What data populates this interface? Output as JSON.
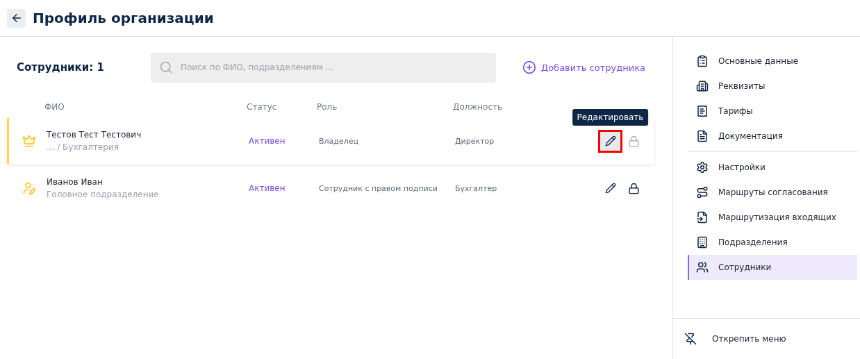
{
  "header": {
    "title": "Профиль организации"
  },
  "toolbar": {
    "count_label": "Сотрудники: 1",
    "search": {
      "placeholder": "Поиск по ФИО, подразделениям ..."
    },
    "add_button": "Добавить сотрудника"
  },
  "table": {
    "columns": [
      "ФИО",
      "Статус",
      "Роль",
      "Должность"
    ],
    "rows": [
      {
        "kind": "owner",
        "highlighted": true,
        "name": "Тестов Тест Тестович",
        "department": "... / Бухгалтерия",
        "status": "Активен",
        "role": "Владелец",
        "position": "Директор",
        "edit_focused": true,
        "edit_tooltip": "Редактировать",
        "lock_disabled": true
      },
      {
        "kind": "signer",
        "highlighted": false,
        "name": "Иванов Иван",
        "department": "Головное подразделение",
        "status": "Активен",
        "role": "Сотрудник с правом подписи",
        "position": "Бухгалтер",
        "edit_focused": false,
        "lock_disabled": false
      }
    ]
  },
  "sidebar": {
    "groups": [
      [
        {
          "label": "Основные данные",
          "selected": false
        },
        {
          "label": "Реквизиты",
          "selected": false
        },
        {
          "label": "Тарифы",
          "selected": false
        },
        {
          "label": "Документация",
          "selected": false
        }
      ],
      [
        {
          "label": "Настройки",
          "selected": false
        },
        {
          "label": "Маршруты согласования",
          "selected": false
        },
        {
          "label": "Маршрутизация входящих",
          "selected": false
        },
        {
          "label": "Подразделения",
          "selected": false
        },
        {
          "label": "Сотрудники",
          "selected": true
        }
      ]
    ],
    "unpin": "Открепить меню"
  }
}
